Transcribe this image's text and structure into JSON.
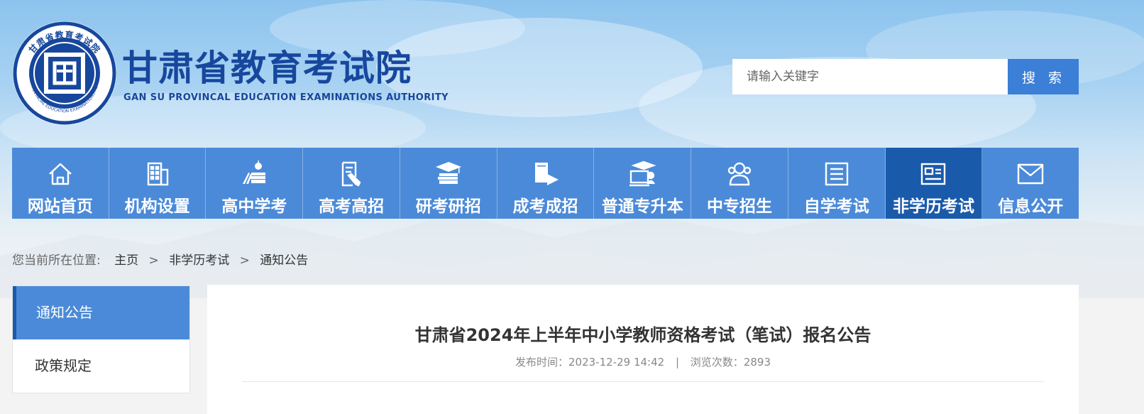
{
  "header": {
    "title": "甘肃省教育考试院",
    "subtitle": "GAN SU PROVINCAL EDUCATION EXAMINATIONS AUTHORITY",
    "logo_ring_text": "甘肃省教育考试院",
    "logo_ring_text_en": "GANSU PROVINCIAL EDUCATION EXAMINATIONS AUTHORITY"
  },
  "search": {
    "placeholder": "请输入关键字",
    "button_label": "搜 索"
  },
  "nav": {
    "items": [
      {
        "label": "网站首页",
        "icon": "home-icon",
        "active": false
      },
      {
        "label": "机构设置",
        "icon": "building-icon",
        "active": false
      },
      {
        "label": "高中学考",
        "icon": "books-apple-icon",
        "active": false
      },
      {
        "label": "高考高招",
        "icon": "document-pen-icon",
        "active": false
      },
      {
        "label": "研考研招",
        "icon": "graduation-books-icon",
        "active": false
      },
      {
        "label": "成考成招",
        "icon": "book-flag-icon",
        "active": false
      },
      {
        "label": "普通专升本",
        "icon": "graduate-screen-icon",
        "active": false
      },
      {
        "label": "中专招生",
        "icon": "users-icon",
        "active": false
      },
      {
        "label": "自学考试",
        "icon": "notebook-icon",
        "active": false
      },
      {
        "label": "非学历考试",
        "icon": "id-card-icon",
        "active": true
      },
      {
        "label": "信息公开",
        "icon": "envelope-icon",
        "active": false
      }
    ]
  },
  "breadcrumb": {
    "prefix": "您当前所在位置:",
    "items": [
      "主页",
      "非学历考试",
      "通知公告"
    ],
    "separator": ">"
  },
  "sidebar": {
    "items": [
      {
        "label": "通知公告",
        "active": true
      },
      {
        "label": "政策规定",
        "active": false
      }
    ]
  },
  "article": {
    "title": "甘肃省2024年上半年中小学教师资格考试（笔试）报名公告",
    "publish_label": "发布时间：",
    "publish_time": "2023-12-29 14:42",
    "meta_divider": "|",
    "views_label": "浏览次数：",
    "views": "2893"
  },
  "colors": {
    "brand_blue": "#17479d",
    "nav_blue": "#4b8ad8",
    "nav_active": "#1a5aab",
    "search_button": "#3b7fd6"
  }
}
